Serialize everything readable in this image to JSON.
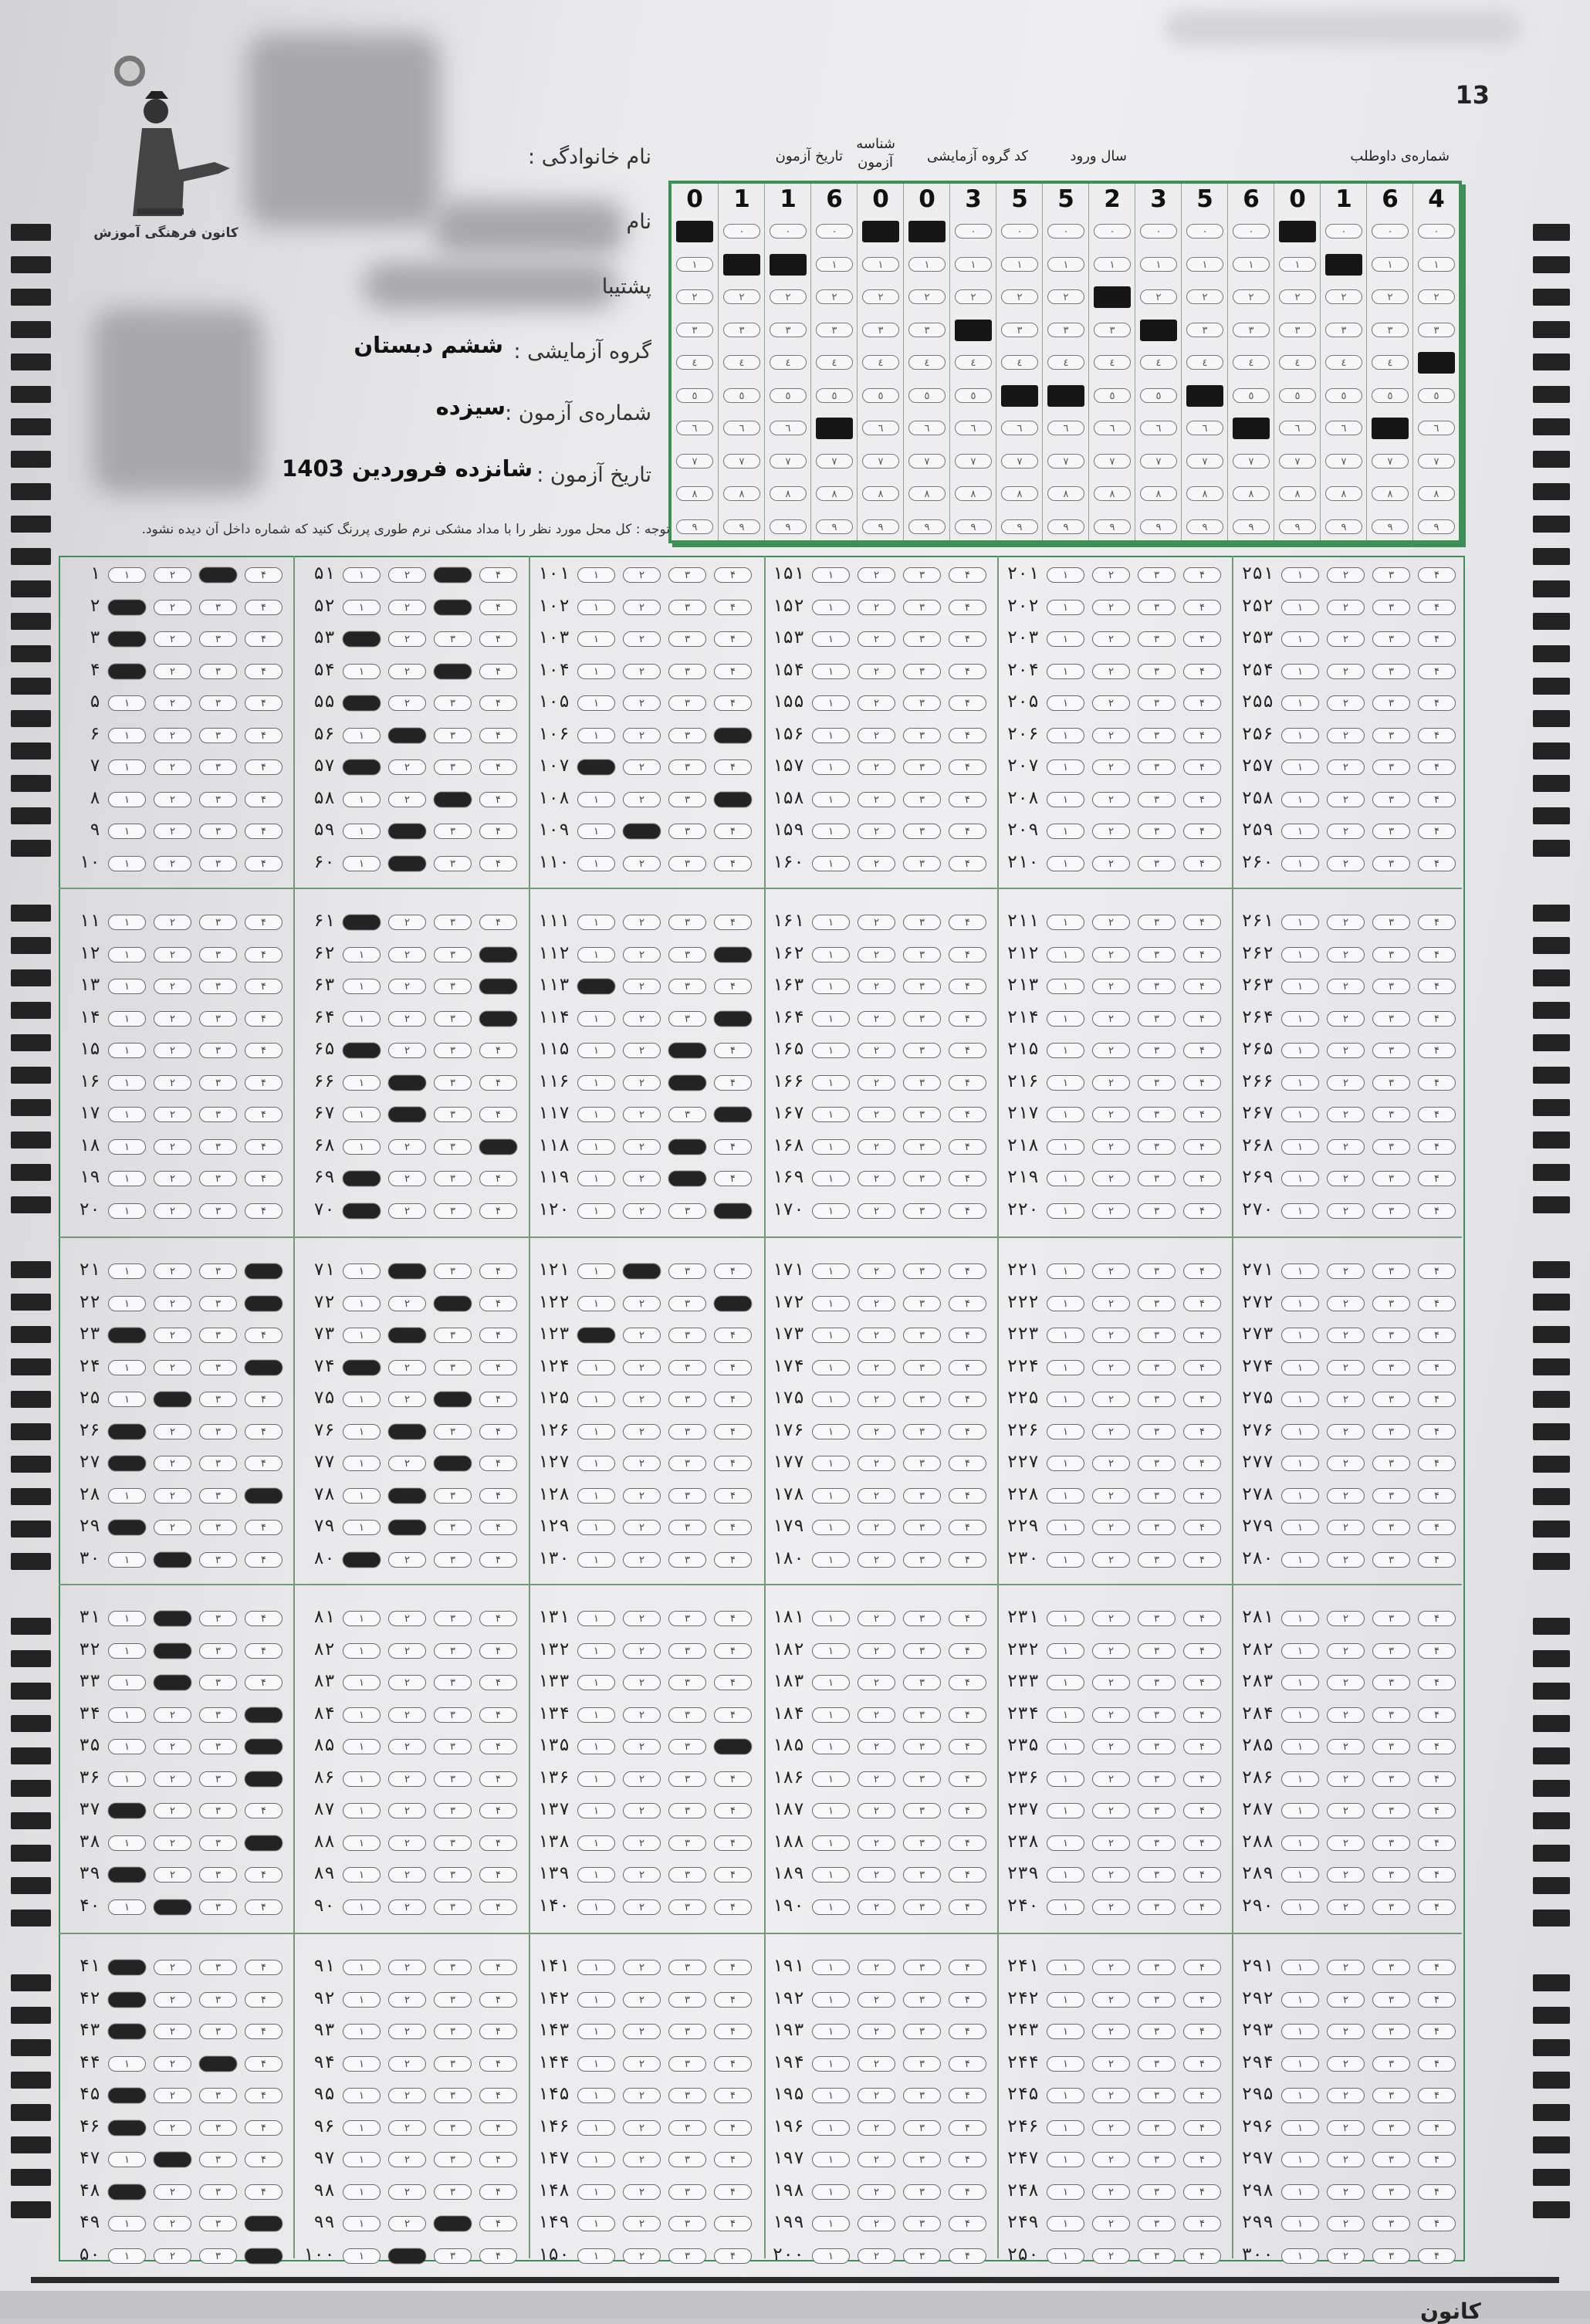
{
  "page_number": "13",
  "logo": {
    "caption": "کانون فرهنگی آموزش",
    "icon": "kanoon-logo-icon"
  },
  "fields": {
    "family_name_label": "نام خانوادگی :",
    "first_name_label": "نام",
    "backup_label": "پشتیبا",
    "group_label": "گروه آزمایشی :",
    "group_value": "ششم دبستان",
    "exam_number_label": "شماره‌ی آزمون :",
    "exam_number_value": "سیزده",
    "exam_date_label": "تاریخ آزمون :",
    "exam_date_value": "شانزده فروردین 1403"
  },
  "code_grid": {
    "headers": {
      "candidate_number": "شماره‌ی داوطلب",
      "entry_year": "سال ورود",
      "group_code": "کد گروه آزمایشی",
      "exam_id_line1": "شناسه",
      "exam_id_line2": "آزمون",
      "exam_date": "تاریخ آزمون"
    },
    "digits": [
      "0",
      "1",
      "1",
      "6",
      "0",
      "0",
      "3",
      "5",
      "5",
      "2",
      "3",
      "5",
      "6",
      "0",
      "1",
      "6",
      "4"
    ],
    "bubble_labels": [
      "٠",
      "١",
      "٢",
      "٣",
      "٤",
      "٥",
      "٦",
      "٧",
      "٨",
      "٩"
    ]
  },
  "notice": "توجه : کل محل مورد نظر را با مداد مشکی نرم طوری پررنگ کنید که شماره داخل آن دیده نشود.",
  "answer_sheet": {
    "choice_labels": [
      "۱",
      "۲",
      "۳",
      "۴"
    ],
    "answers": [
      3,
      1,
      1,
      1,
      0,
      0,
      0,
      0,
      0,
      0,
      0,
      0,
      0,
      0,
      0,
      0,
      0,
      0,
      0,
      0,
      4,
      4,
      1,
      4,
      2,
      1,
      1,
      4,
      1,
      2,
      2,
      2,
      2,
      4,
      4,
      4,
      1,
      4,
      1,
      2,
      1,
      1,
      1,
      3,
      1,
      1,
      2,
      1,
      4,
      4,
      3,
      3,
      1,
      3,
      1,
      2,
      1,
      3,
      2,
      2,
      1,
      4,
      4,
      4,
      1,
      2,
      2,
      4,
      1,
      1,
      2,
      3,
      2,
      1,
      3,
      2,
      3,
      2,
      2,
      1,
      0,
      0,
      0,
      0,
      0,
      0,
      0,
      0,
      0,
      0,
      0,
      0,
      0,
      0,
      0,
      0,
      0,
      0,
      3,
      2,
      0,
      0,
      0,
      0,
      0,
      4,
      1,
      4,
      2,
      0,
      0,
      4,
      1,
      4,
      3,
      3,
      4,
      3,
      3,
      4,
      2,
      4,
      1,
      0,
      0,
      0,
      0,
      0,
      0,
      0,
      0,
      0,
      0,
      0,
      4,
      0,
      0,
      0,
      0,
      0,
      0,
      0,
      0,
      0,
      0,
      0,
      0,
      0,
      0,
      0
    ],
    "total_questions": 300
  },
  "footer": {
    "text": "کانون"
  }
}
